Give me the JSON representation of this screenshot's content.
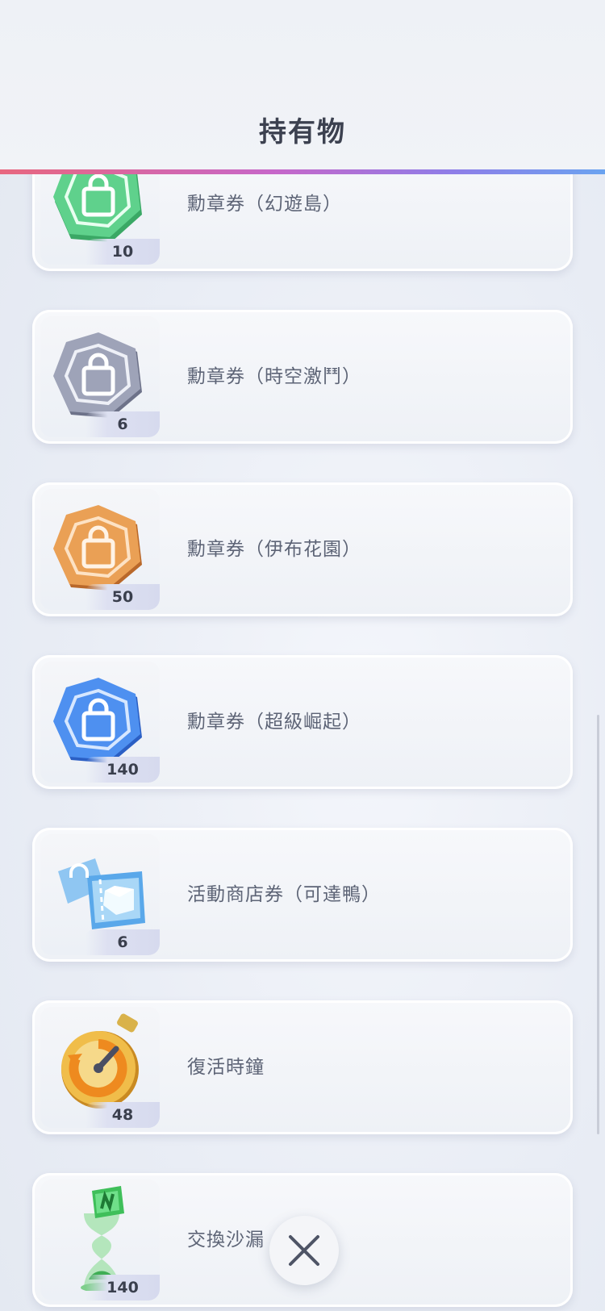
{
  "header": {
    "title": "持有物"
  },
  "items": [
    {
      "name": "勳章券（幻遊島）",
      "quantity": "10",
      "icon": "green-medal-ticket-icon",
      "color": "#4fc27a"
    },
    {
      "name": "勳章券（時空激鬥）",
      "quantity": "6",
      "icon": "gray-medal-ticket-icon",
      "color": "#8a90a6"
    },
    {
      "name": "勳章券（伊布花園）",
      "quantity": "50",
      "icon": "orange-medal-ticket-icon",
      "color": "#e08a3e"
    },
    {
      "name": "勳章券（超級崛起）",
      "quantity": "140",
      "icon": "blue-medal-ticket-icon",
      "color": "#3f7fe8"
    },
    {
      "name": "活動商店券（可達鴨）",
      "quantity": "6",
      "icon": "event-shop-ticket-icon",
      "color": "#7ec3f0"
    },
    {
      "name": "復活時鐘",
      "quantity": "48",
      "icon": "revive-stopwatch-icon",
      "color": "#ee9a2c"
    },
    {
      "name": "交換沙漏",
      "quantity": "140",
      "icon": "exchange-hourglass-icon",
      "color": "#6fd07a"
    }
  ],
  "close_button": {
    "icon": "close-icon"
  }
}
